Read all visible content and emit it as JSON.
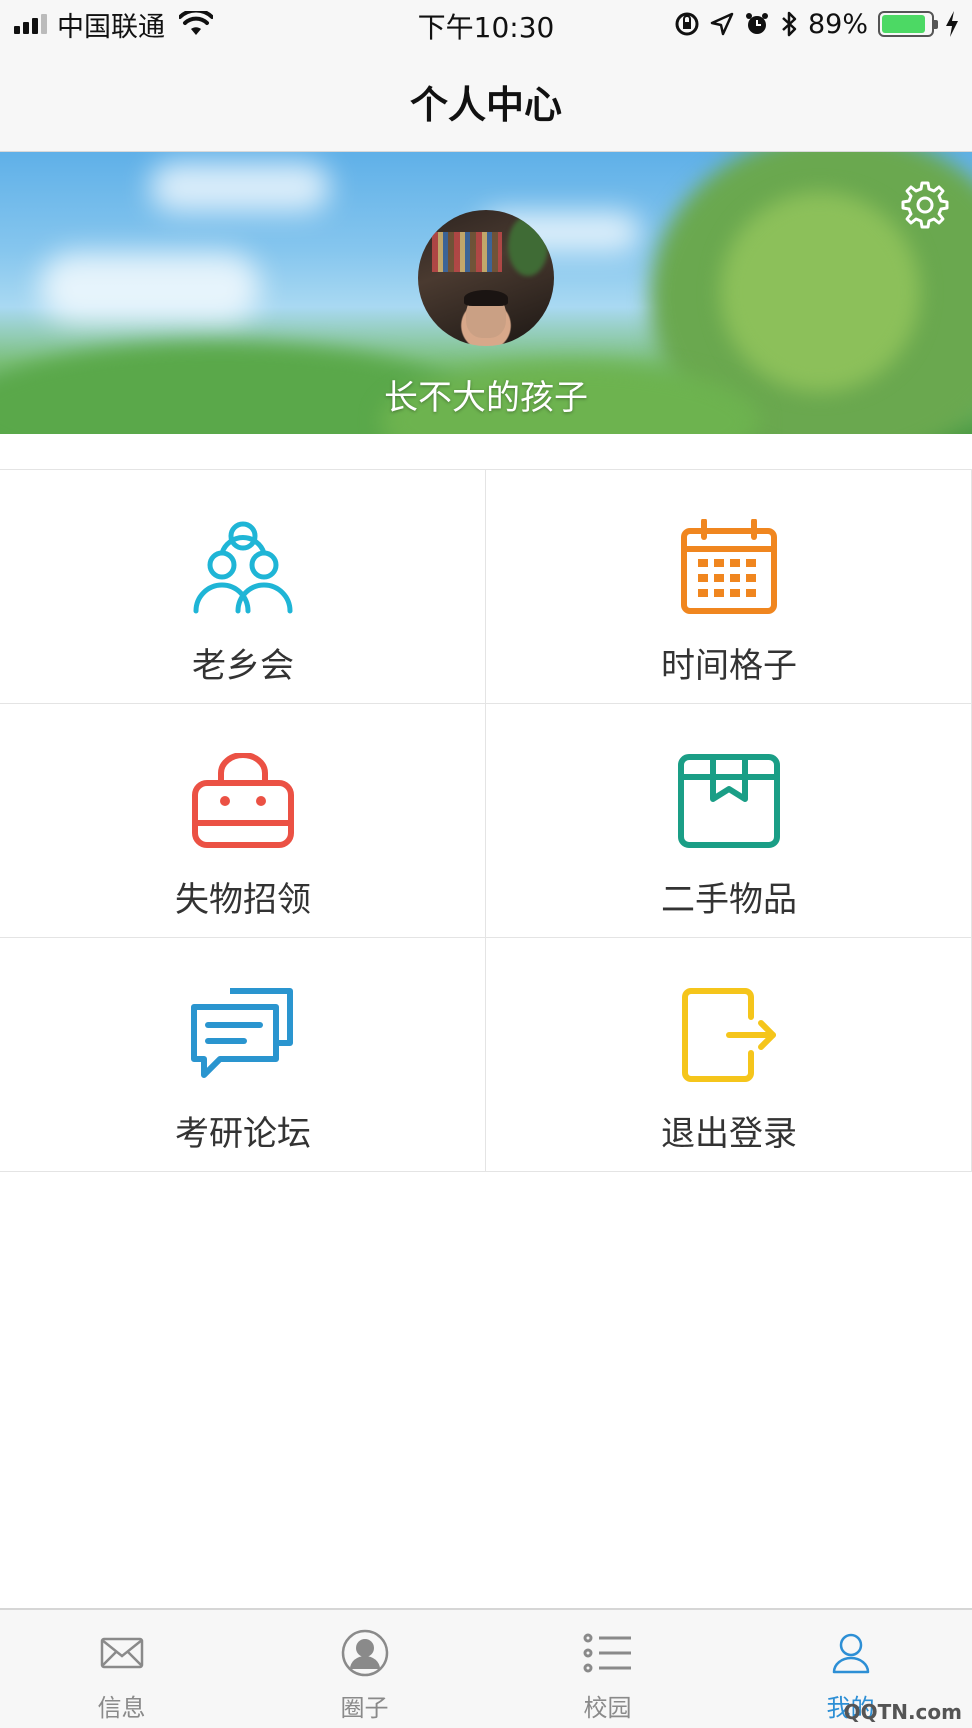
{
  "status_bar": {
    "carrier": "中国联通",
    "time": "下午10:30",
    "battery_percent": "89%",
    "battery_level": 0.89
  },
  "nav": {
    "title": "个人中心"
  },
  "profile": {
    "username": "长不大的孩子",
    "settings_icon": "gear-icon"
  },
  "menu": [
    {
      "label": "老乡会",
      "icon": "people-group-icon",
      "color": "#1fb5d6"
    },
    {
      "label": "时间格子",
      "icon": "calendar-icon",
      "color": "#f0861f"
    },
    {
      "label": "失物招领",
      "icon": "bag-icon",
      "color": "#eb5144"
    },
    {
      "label": "二手物品",
      "icon": "box-icon",
      "color": "#1a9e86"
    },
    {
      "label": "考研论坛",
      "icon": "chat-icon",
      "color": "#2a95cf"
    },
    {
      "label": "退出登录",
      "icon": "logout-icon",
      "color": "#f5c51b"
    }
  ],
  "tabs": [
    {
      "label": "信息",
      "icon": "envelope-icon",
      "active": false
    },
    {
      "label": "圈子",
      "icon": "person-circle-icon",
      "active": false
    },
    {
      "label": "校园",
      "icon": "list-icon",
      "active": false
    },
    {
      "label": "我的",
      "icon": "person-outline-icon",
      "active": true
    }
  ],
  "colors": {
    "active_tab": "#2d8fd5",
    "inactive_tab": "#8a8a8a"
  },
  "watermark": "QQTN.com"
}
